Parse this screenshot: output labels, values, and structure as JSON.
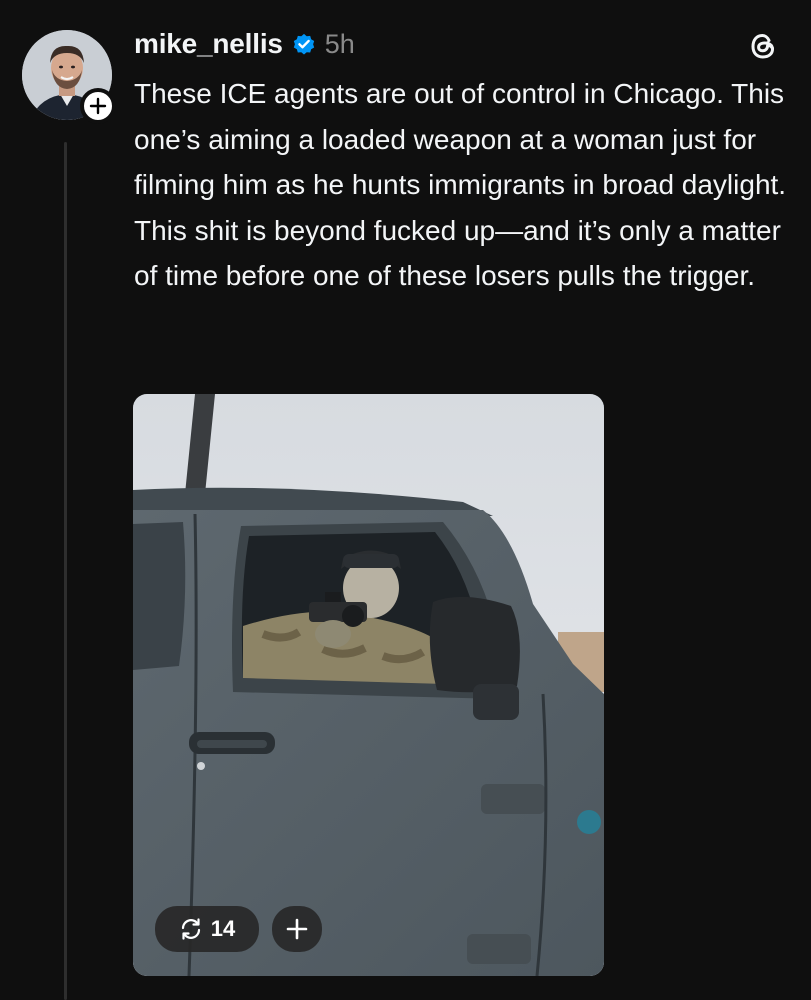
{
  "post": {
    "username": "mike_nellis",
    "timestamp": "5h",
    "verified": true,
    "text": "These ICE agents are out of control in Chicago. This one’s aiming a loaded weapon at a woman just for filming him as he hunts immigrants in broad daylight. This shit is beyond fucked up—and it’s only a matter of time before one of these losers pulls the trigger."
  },
  "media": {
    "repost_count": "14",
    "repost_icon": "repost-icon",
    "add_icon": "plus-icon"
  },
  "icons": {
    "follow": "plus-icon",
    "verified": "verified-badge-icon",
    "app": "threads-logo-icon"
  },
  "colors": {
    "background": "#0f0f0f",
    "text": "#f3f5f7",
    "muted": "#8a8a8a",
    "verified": "#0095f6"
  }
}
